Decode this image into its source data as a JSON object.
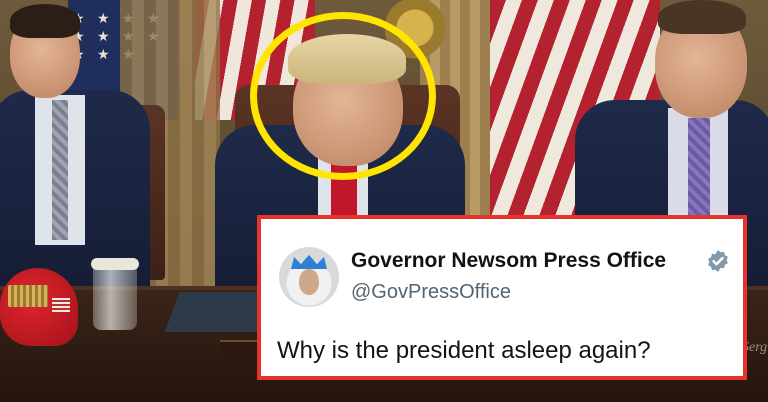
{
  "tweet": {
    "display_name": "Governor Newsom Press Office",
    "handle": "@GovPressOffice",
    "text": "Why is the president asleep again?",
    "verified": true,
    "border_color": "#e4342c"
  },
  "annotation": {
    "highlight_color": "#ffe500",
    "shape": "circle"
  },
  "scene": {
    "background_sign_text": "Serg"
  },
  "icons": {
    "verified": "verified-badge-icon",
    "avatar": "profile-avatar"
  }
}
